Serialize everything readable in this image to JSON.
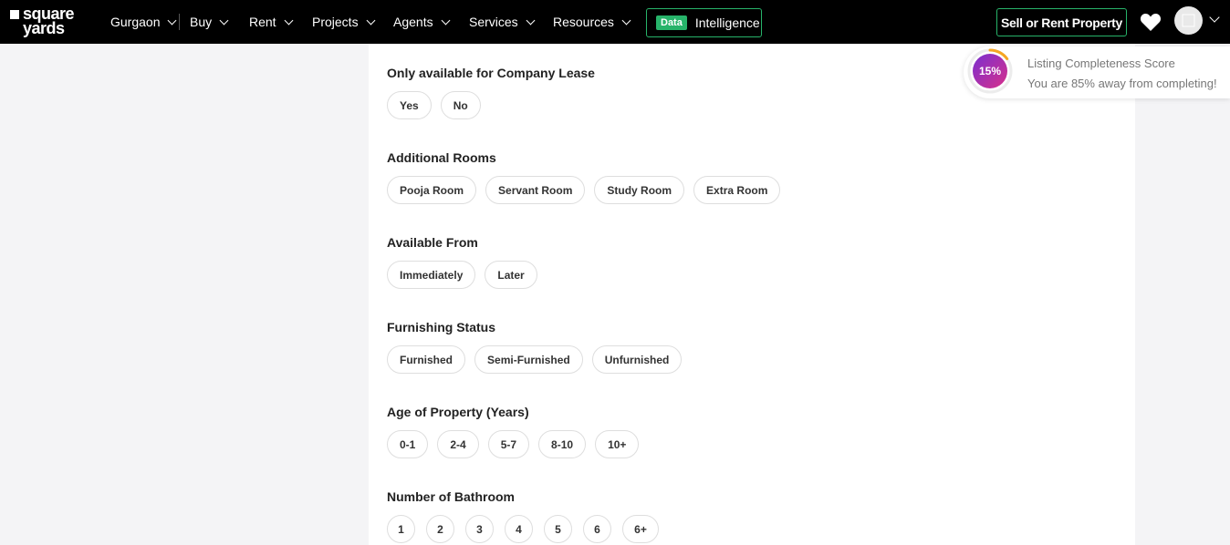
{
  "brand": {
    "line1": "square",
    "line2": "yards"
  },
  "nav": [
    {
      "label": "Gurgaon"
    },
    {
      "label": "Buy"
    },
    {
      "label": "Rent"
    },
    {
      "label": "Projects"
    },
    {
      "label": "Agents"
    },
    {
      "label": "Services"
    },
    {
      "label": "Resources"
    }
  ],
  "data_intelligence": {
    "badge": "Data",
    "label": "Intelligence"
  },
  "header": {
    "sell_label": "Sell or Rent Property",
    "favorites_icon": "heart-icon",
    "avatar_icon": "user-avatar"
  },
  "score": {
    "percent": "15%",
    "title": "Listing Completeness Score",
    "subtitle": "You are 85% away from completing!",
    "value": 0.15,
    "accent": "#f5a623",
    "gradient": [
      "#7a2fd0",
      "#d8308a"
    ]
  },
  "sections": [
    {
      "title": "Only available for Company Lease",
      "options": [
        "Yes",
        "No"
      ]
    },
    {
      "title": "Additional Rooms",
      "options": [
        "Pooja Room",
        "Servant Room",
        "Study Room",
        "Extra Room"
      ]
    },
    {
      "title": "Available From",
      "options": [
        "Immediately",
        "Later"
      ]
    },
    {
      "title": "Furnishing Status",
      "options": [
        "Furnished",
        "Semi-Furnished",
        "Unfurnished"
      ]
    },
    {
      "title": "Age of Property (Years)",
      "options": [
        "0-1",
        "2-4",
        "5-7",
        "8-10",
        "10+"
      ]
    },
    {
      "title": "Number of Bathroom",
      "options": [
        "1",
        "2",
        "3",
        "4",
        "5",
        "6",
        "6+"
      ]
    }
  ],
  "colors": {
    "topbar": "#000000",
    "accent_green": "#27b36a",
    "page_bg": "#f4f4f6"
  }
}
